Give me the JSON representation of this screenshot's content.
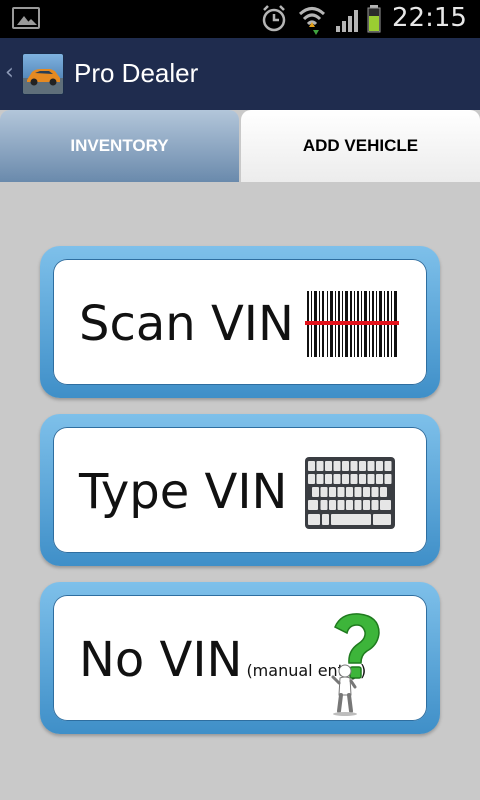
{
  "status_bar": {
    "time": "22:15",
    "icons": [
      "gallery-icon",
      "alarm-icon",
      "wifi-icon",
      "signal-icon",
      "battery-icon"
    ]
  },
  "action_bar": {
    "title": "Pro Dealer"
  },
  "tabs": [
    {
      "label": "INVENTORY",
      "selected": false
    },
    {
      "label": "ADD VEHICLE",
      "selected": true
    }
  ],
  "options": [
    {
      "label": "Scan VIN",
      "sub": "",
      "icon": "barcode-icon"
    },
    {
      "label": "Type VIN",
      "sub": "",
      "icon": "keyboard-icon"
    },
    {
      "label": "No VIN",
      "sub": "(manual entry)",
      "icon": "question-person-icon"
    }
  ],
  "colors": {
    "action_bar": "#1f2c4e",
    "card_border": "#4f9fd6",
    "background": "#c9c9c9",
    "question_mark": "#3db53a"
  }
}
